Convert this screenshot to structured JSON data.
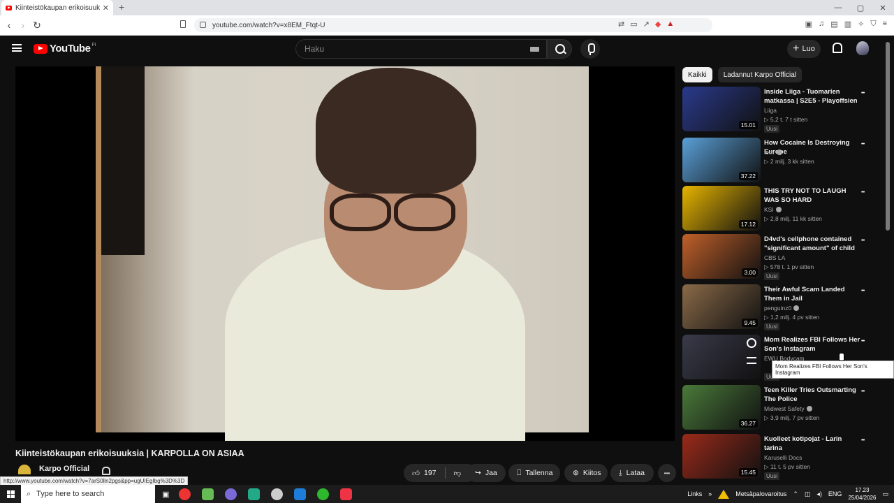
{
  "browser": {
    "tab_title": "Kiinteistökaupan erikoisuuksi...",
    "tab_close": "✕",
    "new_tab": "+",
    "url": "youtube.com/watch?v=x8EM_Ftqt-U",
    "window_controls": [
      "—",
      "▢",
      "✕"
    ]
  },
  "header": {
    "logo_text": "YouTube",
    "logo_region": "FI",
    "search_placeholder": "Haku",
    "create_label": "Luo",
    "create_icon": "+"
  },
  "video": {
    "title": "Kiinteistökaupan erikoisuuksia | KARPOLLA ON ASIAA",
    "channel": "Karpo Official",
    "likes": "197",
    "share": "Jaa",
    "save": "Tallenna",
    "thanks": "Kiitos",
    "download": "Lataa",
    "more": "•••"
  },
  "sidebar": {
    "chips": [
      "Kaikki",
      "Ladannut Karpo Official"
    ],
    "items": [
      {
        "title": "Inside Liiga - Tuomarien matkassa | S2E5 - Playoffsien ...",
        "channel": "Liiga",
        "meta": "▷ 5,2 t.  7 t sitten",
        "badge": "Uusi",
        "duration": "15.01",
        "thumb": "#2a3a8c",
        "verified": false
      },
      {
        "title": "How Cocaine Is Destroying Europe",
        "channel": "fern",
        "meta": "▷ 2 milj.  3 kk sitten",
        "badge": "",
        "duration": "37.22",
        "thumb": "#5aa0d8",
        "verified": true
      },
      {
        "title": "THIS TRY NOT TO LAUGH WAS SO HARD",
        "channel": "KSI",
        "meta": "▷ 2,8 milj.  11 kk sitten",
        "badge": "",
        "duration": "17.12",
        "thumb": "#e6b400",
        "verified": true
      },
      {
        "title": "D4vd's cellphone contained \"significant amount\" of child ...",
        "channel": "CBS LA",
        "meta": "▷ 578 t.  1 pv sitten",
        "badge": "Uusi",
        "duration": "3.00",
        "thumb": "#c0602a",
        "verified": false
      },
      {
        "title": "Their Awful Scam Landed Them in Jail",
        "channel": "penguinz0",
        "meta": "▷ 1,2 milj.  4 pv sitten",
        "badge": "Uusi",
        "duration": "9.45",
        "thumb": "#8a6a48",
        "verified": true
      },
      {
        "title": "Mom Realizes FBI Follows Her Son's Instagram",
        "channel": "EWU Bodycam",
        "meta": "",
        "badge": "Uusi",
        "duration": "",
        "thumb": "#3a3a4a",
        "verified": false
      },
      {
        "title": "Teen Killer Tries Outsmarting The Police",
        "channel": "Midwest Safety",
        "meta": "▷ 3,9 milj.  7 pv sitten",
        "badge": "",
        "duration": "36.27",
        "thumb": "#4a7a3a",
        "verified": true
      },
      {
        "title": "Kuolleet kotipojat - Larin tarina",
        "channel": "Karuselli Docs",
        "meta": "▷ 11 t.  5 pv sitten",
        "badge": "Uusi",
        "duration": "15.45",
        "thumb": "#9a2a1a",
        "verified": false
      }
    ],
    "tooltip": "Mom Realizes FBI Follows Her Son's Instagram"
  },
  "status_url": "http://www.youtube.com/watch?v=7arS0lln2pgs&pp=ugUIEgIbg%3D%3D",
  "taskbar": {
    "search_placeholder": "Type here to search",
    "links": "Links",
    "weather": "Metsäpalovaroitus",
    "language": "ENG",
    "time": "17.23",
    "date": "25/04/2026",
    "app_colors": [
      "#e33",
      "#6b5",
      "#7a6ad8",
      "#2a8",
      "#ccc",
      "#1e7dd8",
      "#2eb82e",
      "#e34"
    ]
  }
}
